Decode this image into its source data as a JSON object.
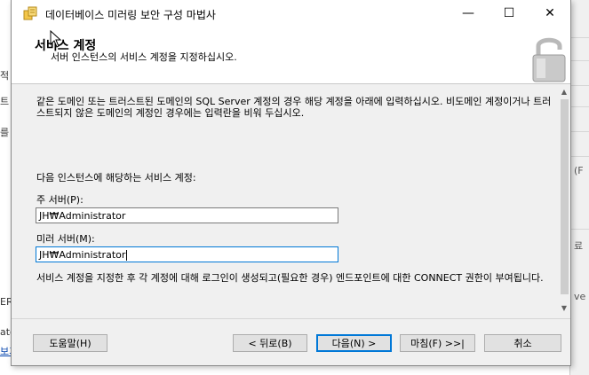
{
  "background": {
    "left_fragments": [
      "적",
      "트",
      "를 전",
      "ER",
      "ator",
      "보기"
    ],
    "right_fragments": [
      "(F",
      "료",
      "ve"
    ]
  },
  "window": {
    "title": "데이터베이스 미러링 보안 구성 마법사",
    "minimize_glyph": "—",
    "maximize_glyph": "☐",
    "close_glyph": "✕"
  },
  "header": {
    "title": "서비스 계정",
    "description": "서버 인스턴스의 서비스 계정을 지정하십시오."
  },
  "body": {
    "intro": "같은 도메인 또는 트러스트된 도메인의 SQL Server 계정의 경우 해당 계정을 아래에 입력하십시오. 비도메인 계정이거나 트러스트되지 않은 도메인의 계정인 경우에는 입력란을 비워 두십시오.",
    "section_label": "다음 인스턴스에 해당하는 서비스 계정:",
    "principal_label": "주 서버(P):",
    "principal_value": "JH₩Administrator",
    "mirror_label": "미러 서버(M):",
    "mirror_value": "JH₩Administrator",
    "note": "서비스 계정을 지정한 후 각 계정에 대해 로그인이 생성되고(필요한 경우) 엔드포인트에 대한 CONNECT 권한이 부여됩니다."
  },
  "buttons": {
    "help": "도움말(H)",
    "back": "< 뒤로(B)",
    "next": "다음(N) >",
    "finish": "마침(F) >>|",
    "cancel": "취소"
  },
  "colors": {
    "dialog_bg": "#f0f0f0",
    "focus_accent": "#0078d7"
  }
}
